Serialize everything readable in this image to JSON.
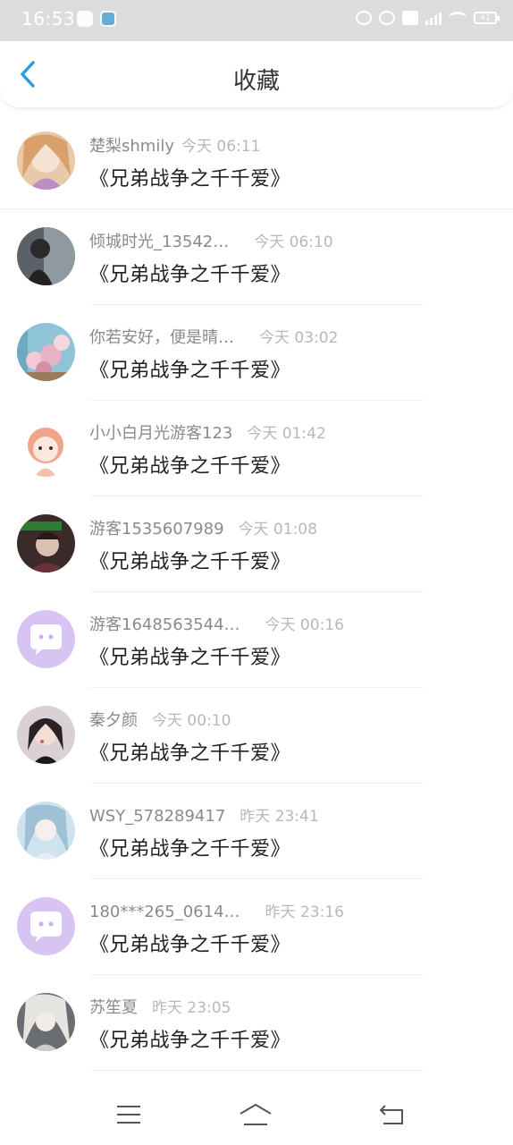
{
  "status_bar": {
    "time": "16:53",
    "battery": "41"
  },
  "header": {
    "title": "收藏",
    "back_icon": "chevron-left-icon",
    "accent_color": "#2d9cdb"
  },
  "favorites": [
    {
      "username": "楚梨shmily",
      "time": "今天 06:11",
      "book": "《兄弟战争之千千爱》",
      "avatar": "anime-girl-sketch"
    },
    {
      "username": "倾城时光_13542…",
      "time": "今天 06:10",
      "book": "《兄弟战争之千千爱》",
      "avatar": "dark-photo"
    },
    {
      "username": "你若安好，便是晴…",
      "time": "今天 03:02",
      "book": "《兄弟战争之千千爱》",
      "avatar": "flowers"
    },
    {
      "username": "小小白月光游客123",
      "time": "今天 01:42",
      "book": "《兄弟战争之千千爱》",
      "avatar": "cartoon-girl"
    },
    {
      "username": "游客1535607989",
      "time": "今天 01:08",
      "book": "《兄弟战争之千千爱》",
      "avatar": "man-portrait"
    },
    {
      "username": "游客1648563544…",
      "time": "今天 00:16",
      "book": "《兄弟战争之千千爱》",
      "avatar": "default-chat-bubble"
    },
    {
      "username": "秦夕颜",
      "time": "今天 00:10",
      "book": "《兄弟战争之千千爱》",
      "avatar": "woman-portrait"
    },
    {
      "username": "WSY_578289417",
      "time": "昨天 23:41",
      "book": "《兄弟战争之千千爱》",
      "avatar": "anime-blue-hair"
    },
    {
      "username": "180***265_0614…",
      "time": "昨天 23:16",
      "book": "《兄弟战争之千千爱》",
      "avatar": "default-chat-bubble"
    },
    {
      "username": "苏笙夏",
      "time": "昨天 23:05",
      "book": "《兄弟战争之千千爱》",
      "avatar": "anime-white-hair"
    }
  ],
  "bottom_nav": {
    "menu_icon": "menu-icon",
    "home_icon": "home-icon",
    "back_icon": "back-arrow-icon"
  }
}
